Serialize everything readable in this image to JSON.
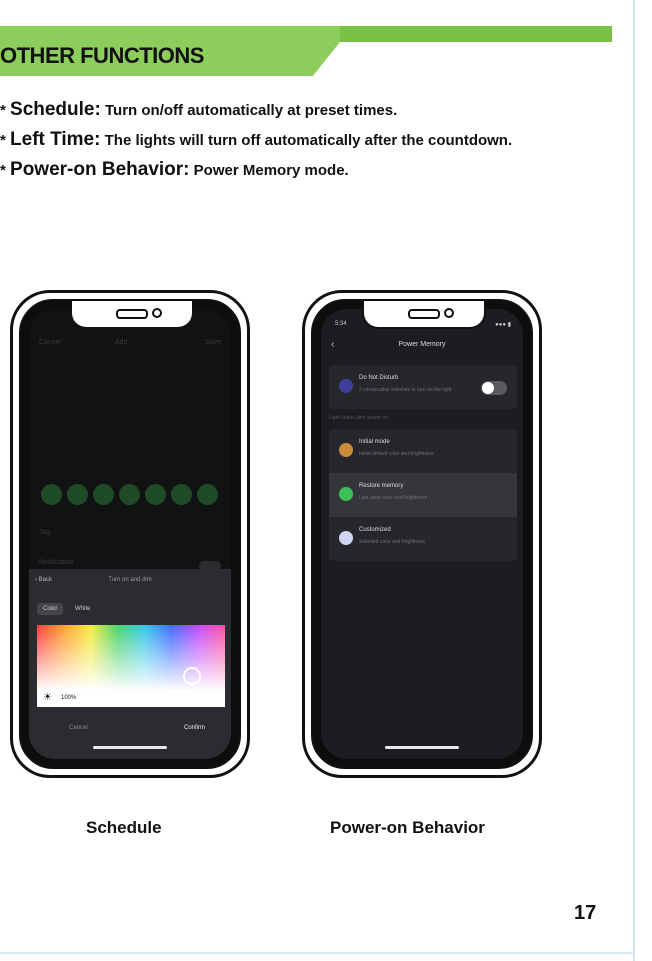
{
  "section": {
    "title": "OTHER FUNCTIONS",
    "accent": "#7ac143"
  },
  "bullets": [
    {
      "key": "Schedule:",
      "text": "Turn on/off automatically at preset times."
    },
    {
      "key": "Left Time:",
      "text": "The lights will turn off automatically after the countdown."
    },
    {
      "key": "Power-on Behavior:",
      "text": "Power Memory mode."
    }
  ],
  "schedule_phone": {
    "header": {
      "cancel": "Cancel",
      "add": "Add",
      "save": "Save"
    },
    "tag_label": "Tag",
    "notification_label": "Notification",
    "sheet": {
      "back": "Back",
      "title": "Turn on and dim",
      "tabs": [
        "Color",
        "White"
      ],
      "brightness": "100%",
      "cancel": "Cancel",
      "confirm": "Confirm"
    },
    "caption": "Schedule"
  },
  "power_phone": {
    "time": "5:34",
    "title": "Power Memory",
    "dnd": {
      "title": "Do Not Disturb",
      "subtitle": "2 consecutive switches to turn on the light",
      "enabled": true
    },
    "section_label": "Light status after power on",
    "options": [
      {
        "title": "Initial mode",
        "subtitle": "Initial default color and brightness",
        "color": "#c98a3a",
        "selected": false
      },
      {
        "title": "Restore memory",
        "subtitle": "Last used color and brightness",
        "color": "#3fbf5a",
        "selected": true
      },
      {
        "title": "Customized",
        "subtitle": "Selected color and brightness",
        "color": "#cfd6f5",
        "selected": false
      }
    ],
    "caption": "Power-on Behavior"
  },
  "page_number": "17"
}
